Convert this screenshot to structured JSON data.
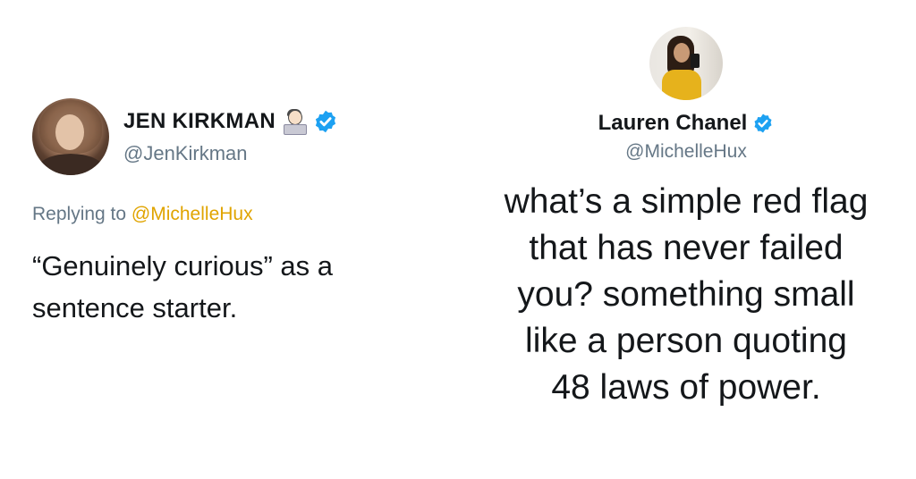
{
  "left_tweet": {
    "display_name": "JEN KIRKMAN",
    "handle": "@JenKirkman",
    "replying_prefix": "Replying to ",
    "replying_mention": "@MichelleHux",
    "text_line1": "“Genuinely curious” as a",
    "text_line2": "sentence starter.",
    "emoji_icon": "woman-technologist-icon",
    "verified_icon": "verified-badge-icon"
  },
  "right_tweet": {
    "display_name": "Lauren Chanel",
    "handle": "@MichelleHux",
    "text": "what’s a simple red flag\nthat has never failed\nyou? something small\nlike a person quoting\n48 laws of power.",
    "verified_icon": "verified-badge-icon"
  },
  "colors": {
    "text": "#14171a",
    "secondary": "#657786",
    "mention": "#e0a400",
    "verified": "#1da1f2"
  }
}
